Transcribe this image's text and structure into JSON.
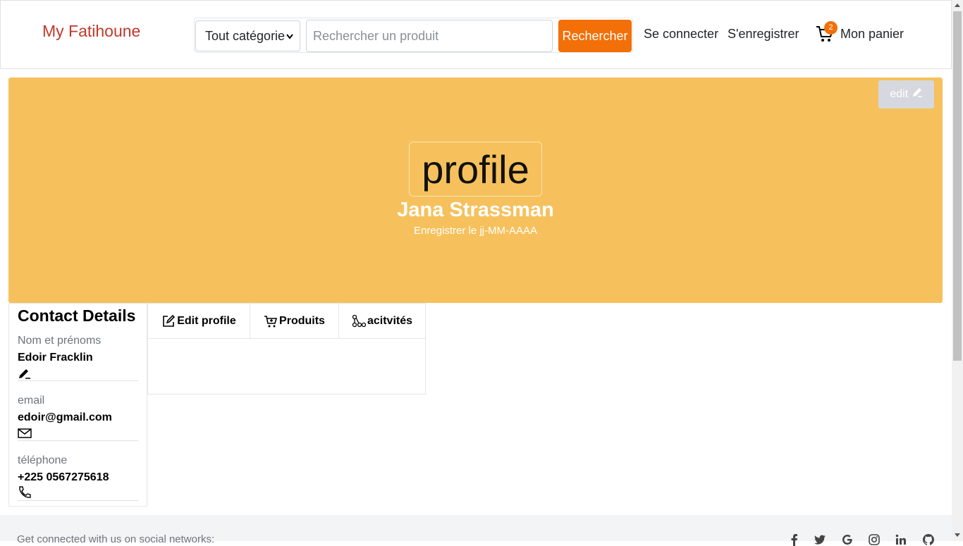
{
  "header": {
    "brand": "My Fatihoune",
    "category_select_value": "Tout catégorie",
    "search_placeholder": "Rechercher un produit",
    "search_button": "Rechercher",
    "login": "Se connecter",
    "register": "S'enregistrer",
    "cart_count": "2",
    "cart_label": "Mon panier"
  },
  "banner": {
    "edit_label": "edit",
    "profile_image_alt": "profile",
    "name": "Jana Strassman",
    "registered": "Enregistrer le jj-MM-AAAA",
    "background_color": "#f6c15c"
  },
  "contact": {
    "title": "Contact Details",
    "fields": [
      {
        "label": "Nom et prénoms",
        "value": "Edoir Fracklin",
        "icon": "pencil-icon"
      },
      {
        "label": "email",
        "value": "edoir@gmail.com",
        "icon": "envelope-icon"
      },
      {
        "label": "téléphone",
        "value": "+225 0567275618",
        "icon": "phone-icon"
      }
    ]
  },
  "tabs": [
    {
      "label": "Edit profile",
      "icon": "edit-square-icon"
    },
    {
      "label": "Produits",
      "icon": "cart-plus-icon"
    },
    {
      "label": "acitvités",
      "icon": "activity-icon"
    }
  ],
  "footer": {
    "text": "Get connected with us on social networks:",
    "socials": [
      "facebook-icon",
      "twitter-icon",
      "google-icon",
      "instagram-icon",
      "linkedin-icon",
      "github-icon"
    ]
  },
  "colors": {
    "accent": "#f36f07",
    "brand": "#c0392b"
  }
}
